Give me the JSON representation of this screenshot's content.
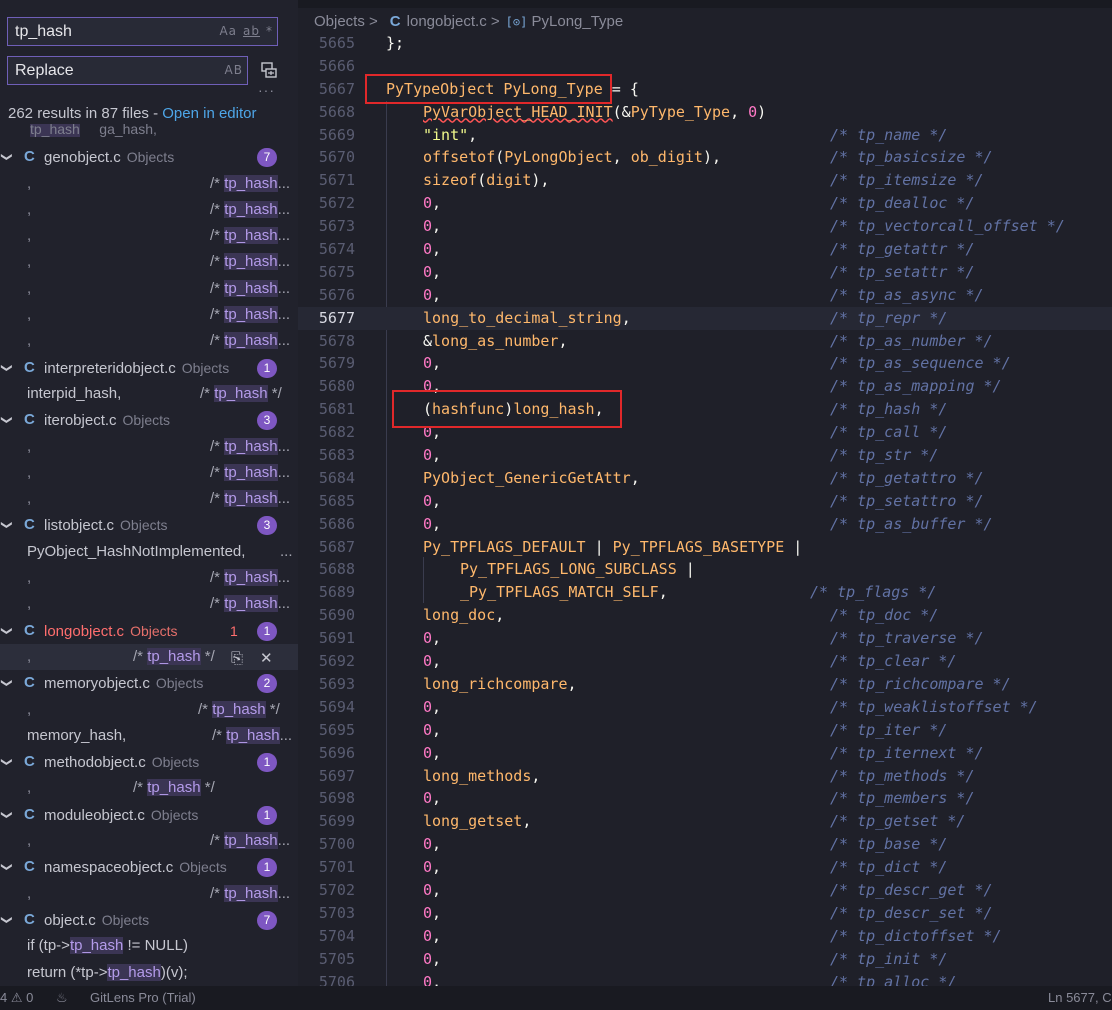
{
  "search": {
    "query": "tp_hash",
    "options": [
      "Aa",
      "ab",
      "*"
    ],
    "replace_placeholder": "Replace",
    "replace_option": "AB",
    "summary": "262 results in 87 files - ",
    "open_in_editor": "Open in editor"
  },
  "partial_row": {
    "a": "tp_hash",
    "b": "ga_hash,"
  },
  "results": [
    {
      "kind": "file",
      "name": "genobject.c",
      "dir": "Objects",
      "badge": "7"
    },
    {
      "kind": "match",
      "pre": ",",
      "hl": "tp_hash",
      "suffix": "...",
      "commentX": 210
    },
    {
      "kind": "match",
      "pre": ",",
      "hl": "tp_hash",
      "suffix": "...",
      "commentX": 210
    },
    {
      "kind": "match",
      "pre": ",",
      "hl": "tp_hash",
      "suffix": "...",
      "commentX": 210
    },
    {
      "kind": "match",
      "pre": ",",
      "hl": "tp_hash",
      "suffix": "...",
      "commentX": 210
    },
    {
      "kind": "match",
      "pre": ",",
      "hl": "tp_hash",
      "suffix": "...",
      "commentX": 210
    },
    {
      "kind": "match",
      "pre": ",",
      "hl": "tp_hash",
      "suffix": "...",
      "commentX": 210
    },
    {
      "kind": "match",
      "pre": ",",
      "hl": "tp_hash",
      "suffix": "...",
      "commentX": 210
    },
    {
      "kind": "file",
      "name": "interpreteridobject.c",
      "dir": "Objects",
      "badge": "1"
    },
    {
      "kind": "match",
      "pre": "interpid_hash,",
      "hl": "tp_hash",
      "suffix": " */",
      "commentX": 200
    },
    {
      "kind": "file",
      "name": "iterobject.c",
      "dir": "Objects",
      "badge": "3"
    },
    {
      "kind": "match",
      "pre": ",",
      "hl": "tp_hash",
      "suffix": "...",
      "commentX": 210
    },
    {
      "kind": "match",
      "pre": ",",
      "hl": "tp_hash",
      "suffix": "...",
      "commentX": 210
    },
    {
      "kind": "match",
      "pre": ",",
      "hl": "tp_hash",
      "suffix": "...",
      "commentX": 210
    },
    {
      "kind": "file",
      "name": "listobject.c",
      "dir": "Objects",
      "badge": "3"
    },
    {
      "kind": "match",
      "pre": "PyObject_HashNotImplemented,",
      "hl": "",
      "suffix": "...",
      "commentX": 280
    },
    {
      "kind": "match",
      "pre": ",",
      "hl": "tp_hash",
      "suffix": "...",
      "commentX": 210
    },
    {
      "kind": "match",
      "pre": ",",
      "hl": "tp_hash",
      "suffix": "...",
      "commentX": 210
    },
    {
      "kind": "file",
      "name": "longobject.c",
      "dir": "Objects",
      "badge": "1",
      "count": "1",
      "red": true
    },
    {
      "kind": "match",
      "pre": ",",
      "hl": "tp_hash",
      "suffix": " */",
      "commentX": 133,
      "selected": true
    },
    {
      "kind": "file",
      "name": "memoryobject.c",
      "dir": "Objects",
      "badge": "2"
    },
    {
      "kind": "match",
      "pre": ",",
      "hl": "tp_hash",
      "suffix": " */",
      "commentX": 198
    },
    {
      "kind": "match",
      "pre": "memory_hash,",
      "hl": "tp_hash",
      "suffix": "...",
      "commentX": 212
    },
    {
      "kind": "file",
      "name": "methodobject.c",
      "dir": "Objects",
      "badge": "1"
    },
    {
      "kind": "match",
      "pre": ",",
      "hl": "tp_hash",
      "suffix": " */",
      "commentX": 133
    },
    {
      "kind": "file",
      "name": "moduleobject.c",
      "dir": "Objects",
      "badge": "1"
    },
    {
      "kind": "match",
      "pre": ",",
      "hl": "tp_hash",
      "suffix": "...",
      "commentX": 210
    },
    {
      "kind": "file",
      "name": "namespaceobject.c",
      "dir": "Objects",
      "badge": "1"
    },
    {
      "kind": "match",
      "pre": ",",
      "hl": "tp_hash",
      "suffix": "...",
      "commentX": 210
    },
    {
      "kind": "file",
      "name": "object.c",
      "dir": "Objects",
      "badge": "7"
    },
    {
      "kind": "code",
      "a": "if (tp->",
      "hl": "tp_hash",
      "b": " != NULL)"
    },
    {
      "kind": "code",
      "a": "return (*tp->",
      "hl": "tp_hash",
      "b": ")(v);"
    }
  ],
  "breadcrumb": {
    "folder": "Objects",
    "file": "longobject.c",
    "symbol": "PyLong_Type"
  },
  "code_lines": [
    {
      "n": "5665",
      "t": [
        [
          "p",
          "};"
        ]
      ]
    },
    {
      "n": "5666",
      "t": []
    },
    {
      "n": "5667",
      "t": [
        [
          "k",
          "PyTypeObject"
        ],
        [
          "w",
          " "
        ],
        [
          "k",
          "PyLong_Type"
        ],
        [
          "w",
          " = {"
        ]
      ]
    },
    {
      "n": "5668",
      "t": [
        [
          "ksq",
          "PyVarObject_HEAD_INIT"
        ],
        [
          "w",
          "(&"
        ],
        [
          "k",
          "PyType_Type"
        ],
        [
          "w",
          ", "
        ],
        [
          "n",
          "0"
        ],
        [
          "w",
          ")"
        ]
      ],
      "i": 1
    },
    {
      "n": "5669",
      "t": [
        [
          "s",
          "\"int\""
        ],
        [
          "w",
          ","
        ]
      ],
      "c": "/* tp_name */",
      "i": 1
    },
    {
      "n": "5670",
      "t": [
        [
          "k",
          "offsetof"
        ],
        [
          "w",
          "("
        ],
        [
          "k",
          "PyLongObject"
        ],
        [
          "w",
          ", "
        ],
        [
          "k",
          "ob_digit"
        ],
        [
          "w",
          "),"
        ]
      ],
      "c": "/* tp_basicsize */",
      "i": 1
    },
    {
      "n": "5671",
      "t": [
        [
          "k",
          "sizeof"
        ],
        [
          "w",
          "("
        ],
        [
          "k",
          "digit"
        ],
        [
          "w",
          "),"
        ]
      ],
      "c": "/* tp_itemsize */",
      "i": 1
    },
    {
      "n": "5672",
      "t": [
        [
          "n",
          "0"
        ],
        [
          "w",
          ","
        ]
      ],
      "c": "/* tp_dealloc */",
      "i": 1
    },
    {
      "n": "5673",
      "t": [
        [
          "n",
          "0"
        ],
        [
          "w",
          ","
        ]
      ],
      "c": "/* tp_vectorcall_offset */",
      "i": 1
    },
    {
      "n": "5674",
      "t": [
        [
          "n",
          "0"
        ],
        [
          "w",
          ","
        ]
      ],
      "c": "/* tp_getattr */",
      "i": 1
    },
    {
      "n": "5675",
      "t": [
        [
          "n",
          "0"
        ],
        [
          "w",
          ","
        ]
      ],
      "c": "/* tp_setattr */",
      "i": 1
    },
    {
      "n": "5676",
      "t": [
        [
          "n",
          "0"
        ],
        [
          "w",
          ","
        ]
      ],
      "c": "/* tp_as_async */",
      "i": 1
    },
    {
      "n": "5677",
      "t": [
        [
          "k",
          "long_to_decimal_string"
        ],
        [
          "w",
          ","
        ]
      ],
      "c": "/* tp_repr */",
      "i": 1,
      "cur": true
    },
    {
      "n": "5678",
      "t": [
        [
          "w",
          "&"
        ],
        [
          "k",
          "long_as_number"
        ],
        [
          "w",
          ","
        ]
      ],
      "c": "/* tp_as_number */",
      "i": 1
    },
    {
      "n": "5679",
      "t": [
        [
          "n",
          "0"
        ],
        [
          "w",
          ","
        ]
      ],
      "c": "/* tp_as_sequence */",
      "i": 1
    },
    {
      "n": "5680",
      "t": [
        [
          "n",
          "0"
        ],
        [
          "w",
          ","
        ]
      ],
      "c": "/* tp_as_mapping */",
      "i": 1
    },
    {
      "n": "5681",
      "t": [
        [
          "w",
          "("
        ],
        [
          "k",
          "hashfunc"
        ],
        [
          "w",
          ")"
        ],
        [
          "k",
          "long_hash"
        ],
        [
          "w",
          ","
        ]
      ],
      "c": "/* tp_hash */",
      "i": 1
    },
    {
      "n": "5682",
      "t": [
        [
          "n",
          "0"
        ],
        [
          "w",
          ","
        ]
      ],
      "c": "/* tp_call */",
      "i": 1
    },
    {
      "n": "5683",
      "t": [
        [
          "n",
          "0"
        ],
        [
          "w",
          ","
        ]
      ],
      "c": "/* tp_str */",
      "i": 1
    },
    {
      "n": "5684",
      "t": [
        [
          "k",
          "PyObject_GenericGetAttr"
        ],
        [
          "w",
          ","
        ]
      ],
      "c": "/* tp_getattro */",
      "i": 1
    },
    {
      "n": "5685",
      "t": [
        [
          "n",
          "0"
        ],
        [
          "w",
          ","
        ]
      ],
      "c": "/* tp_setattro */",
      "i": 1
    },
    {
      "n": "5686",
      "t": [
        [
          "n",
          "0"
        ],
        [
          "w",
          ","
        ]
      ],
      "c": "/* tp_as_buffer */",
      "i": 1
    },
    {
      "n": "5687",
      "t": [
        [
          "k",
          "Py_TPFLAGS_DEFAULT"
        ],
        [
          "w",
          " | "
        ],
        [
          "k",
          "Py_TPFLAGS_BASETYPE"
        ],
        [
          "w",
          " |"
        ]
      ],
      "i": 1
    },
    {
      "n": "5688",
      "t": [
        [
          "k",
          "Py_TPFLAGS_LONG_SUBCLASS"
        ],
        [
          "w",
          " |"
        ]
      ],
      "i": 2
    },
    {
      "n": "5689",
      "t": [
        [
          "k",
          "_Py_TPFLAGS_MATCH_SELF"
        ],
        [
          "w",
          ","
        ]
      ],
      "c": "/* tp_flags */",
      "i": 2,
      "cshift": -20
    },
    {
      "n": "5690",
      "t": [
        [
          "k",
          "long_doc"
        ],
        [
          "w",
          ","
        ]
      ],
      "c": "/* tp_doc */",
      "i": 1
    },
    {
      "n": "5691",
      "t": [
        [
          "n",
          "0"
        ],
        [
          "w",
          ","
        ]
      ],
      "c": "/* tp_traverse */",
      "i": 1
    },
    {
      "n": "5692",
      "t": [
        [
          "n",
          "0"
        ],
        [
          "w",
          ","
        ]
      ],
      "c": "/* tp_clear */",
      "i": 1
    },
    {
      "n": "5693",
      "t": [
        [
          "k",
          "long_richcompare"
        ],
        [
          "w",
          ","
        ]
      ],
      "c": "/* tp_richcompare */",
      "i": 1
    },
    {
      "n": "5694",
      "t": [
        [
          "n",
          "0"
        ],
        [
          "w",
          ","
        ]
      ],
      "c": "/* tp_weaklistoffset */",
      "i": 1
    },
    {
      "n": "5695",
      "t": [
        [
          "n",
          "0"
        ],
        [
          "w",
          ","
        ]
      ],
      "c": "/* tp_iter */",
      "i": 1
    },
    {
      "n": "5696",
      "t": [
        [
          "n",
          "0"
        ],
        [
          "w",
          ","
        ]
      ],
      "c": "/* tp_iternext */",
      "i": 1
    },
    {
      "n": "5697",
      "t": [
        [
          "k",
          "long_methods"
        ],
        [
          "w",
          ","
        ]
      ],
      "c": "/* tp_methods */",
      "i": 1
    },
    {
      "n": "5698",
      "t": [
        [
          "n",
          "0"
        ],
        [
          "w",
          ","
        ]
      ],
      "c": "/* tp_members */",
      "i": 1
    },
    {
      "n": "5699",
      "t": [
        [
          "k",
          "long_getset"
        ],
        [
          "w",
          ","
        ]
      ],
      "c": "/* tp_getset */",
      "i": 1
    },
    {
      "n": "5700",
      "t": [
        [
          "n",
          "0"
        ],
        [
          "w",
          ","
        ]
      ],
      "c": "/* tp_base */",
      "i": 1
    },
    {
      "n": "5701",
      "t": [
        [
          "n",
          "0"
        ],
        [
          "w",
          ","
        ]
      ],
      "c": "/* tp_dict */",
      "i": 1
    },
    {
      "n": "5702",
      "t": [
        [
          "n",
          "0"
        ],
        [
          "w",
          ","
        ]
      ],
      "c": "/* tp_descr_get */",
      "i": 1
    },
    {
      "n": "5703",
      "t": [
        [
          "n",
          "0"
        ],
        [
          "w",
          ","
        ]
      ],
      "c": "/* tp_descr_set */",
      "i": 1
    },
    {
      "n": "5704",
      "t": [
        [
          "n",
          "0"
        ],
        [
          "w",
          ","
        ]
      ],
      "c": "/* tp_dictoffset */",
      "i": 1
    },
    {
      "n": "5705",
      "t": [
        [
          "n",
          "0"
        ],
        [
          "w",
          ","
        ]
      ],
      "c": "/* tp_init */",
      "i": 1
    },
    {
      "n": "5706",
      "t": [
        [
          "n",
          "0"
        ],
        [
          "w",
          ","
        ]
      ],
      "c": "/* tp_alloc */",
      "i": 1
    }
  ],
  "statusbar": {
    "problems": "4",
    "warnings": "0",
    "gitlens": "GitLens Pro (Trial)",
    "position": "Ln 5677, C"
  }
}
